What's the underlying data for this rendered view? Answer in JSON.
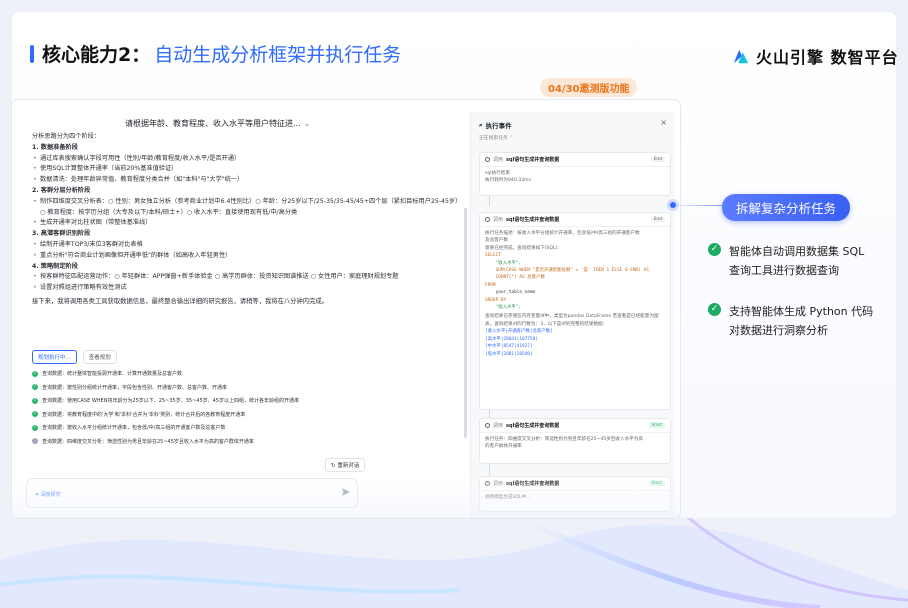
{
  "slide": {
    "title_prefix": "核心能力2：",
    "title_main": "自动生成分析框架并执行任务",
    "brand": "火山引擎 数智平台",
    "beta_badge": "04/30邀测版功能"
  },
  "chat": {
    "question": "请根据年龄、教育程度、收入水平等用户特征进...",
    "intro": "分析思路分为四个阶段：",
    "sections": [
      {
        "title": "1. 数据准备阶段",
        "items": [
          "通过库表搜索确认字段可用性（性别/年龄/教育程度/收入水平/是否开通）",
          "使用SQL计算整体开通率（当前20%基准值验证）",
          "数据清洗：处理年龄异常值、教育程度分类合并（如\"本科\"与\"大学\"统一）"
        ]
      },
      {
        "title": "2. 客群分层分析阶段",
        "items": [
          "制作四维度交叉分析表：○ 性别：男女独立分析（参考商业计划中6.4性别比）○ 年龄：分25岁以下/25-35/35-45/45+四个层（紧扣目标用户25-45岁）○ 教育程度：按学历分组（大专及以下/本科/硕士+）○ 收入水平：直接使用现有低/中/高分类",
          "生成开通率对比柱状图（带整体基准线）"
        ]
      },
      {
        "title": "3. 高潜客群识别阶段",
        "items": [
          "绘制开通率TOP3/末位3客群对比表格",
          "重点分析\"符合商业计划画像但开通率低\"的群体（如高收入年轻男性）"
        ]
      },
      {
        "title": "4. 策略制定阶段",
        "items": [
          "按客群特征匹配运营动作：○ 年轻群体：APP弹窗+新手体验金 ○ 高学历群体：投资知识图谱推送 ○ 女性用户：家庭理财规划专题",
          "设置对照组进行策略有效性测试"
        ]
      }
    ],
    "conclusion": "接下来，我将调用各类工具获取数据信息，最终整合输出详细的研究报告，请稍等，我将在八分钟内完成。",
    "tabs": [
      "规划执行中...",
      "查看规划"
    ],
    "steps": [
      "查询数据：统计整体智能投顾开通率、计算开通数量及总客户数",
      "查询数据：按性别分组统计开通率，字段包含性别、开通客户数、总客户数、开通率",
      "查询数据：使用CASE WHEN将年龄分为25岁以下、25~35岁、35~45岁、45岁以上四组，统计各年龄组的开通率",
      "查询数据：将教育程度中的'大学'和'本科'合并为'本科'类别，统计合并后的各教育程度开通率",
      "查询数据：按收入水平分组统计开通率，包含低/中/高三组的开通客户数及总客户数",
      "查询数据：四维度交叉分析：筛选性别为男且年龄在25~45岁且收入水平为高的客户群体开通率"
    ],
    "retry": "重新对话",
    "input_placeholder": "深度研究"
  },
  "panel": {
    "title": "执行事件",
    "subtitle": "正在搜索任务",
    "cards": [
      {
        "call": "调用",
        "name": "sql语句生成并查询数据",
        "tag": "End",
        "lines": [
          "sql执行结束",
          "执行耗时为940.33ms"
        ]
      },
      {
        "call": "调用",
        "name": "sql语句生成并查询数据",
        "tag": "End",
        "lines": [
          "执行任务描述：按收入水平分组统计开通率，包含低/中/高三组的开通客户数",
          "及总客户数",
          "意果已经完成，查询结果如下(SQL):"
        ],
        "code": [
          "SELECT",
          "    \"收入水平\",",
          "    SUM(CASE WHEN \"是否开通智能投顾\" = '是' THEN 1 ELSE 0 END) AS",
          "    COUNT(*) AS 总客户数",
          "FROM",
          "    your_table_name",
          "GROUP BY",
          "    \"收入水平\";"
        ],
        "result_intro": "查询结果已存储在内存变量df中，类型为pandas DataFrame 若查看是已经能量为图表，查询结果df的行数为：3，以下是df的完整的结果数据：",
        "result_rows": [
          "[收入水平|开通客户数|总客户数]",
          "[高水平|28041|107758]",
          "[中水平|8547|41927]",
          "[低水平|2081|10540]"
        ]
      },
      {
        "call": "调用",
        "name": "sql语句生成并查询数据",
        "tag": "Start",
        "lines": [
          "执行任务：四维度交叉分析：筛选性别为男且年龄在25~45岁且收入水平为高",
          "的客户群体开通率"
        ]
      },
      {
        "call": "调用",
        "name": "sql语句生成并查询数据",
        "tag": "Start",
        "lines": [
          "调用模型生成SQL中..."
        ]
      }
    ]
  },
  "callout": {
    "pill": "拆解复杂分析任务",
    "bullets": [
      [
        "智能体自动调用数据集 SQL",
        "查询工具进行数据查询"
      ],
      [
        "支持智能体生成 Python 代码",
        "对数据进行洞察分析"
      ]
    ]
  },
  "colors": {
    "accent": "#2f6bff",
    "green": "#1faa63",
    "badge": "#e8751a"
  }
}
